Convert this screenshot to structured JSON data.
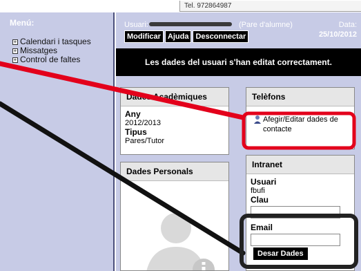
{
  "header": {
    "tel": "Tel. 972864987"
  },
  "menu": {
    "title": "Menú:",
    "items": [
      {
        "label": "Calendari i tasques"
      },
      {
        "label": "Missatges"
      },
      {
        "label": "Control de faltes"
      }
    ]
  },
  "user": {
    "label": "Usuari:",
    "role": "(Pare d'alumne)",
    "date_label": "Data:",
    "date": "25/10/2012"
  },
  "toolbar": {
    "modify": "Modificar",
    "help": "Ajuda",
    "logout": "Desconnectar"
  },
  "banner": "Les dades del usuari s'han editat correctament.",
  "academic": {
    "title": "Dades Acadèmiques",
    "year_label": "Any",
    "year": "2012/2013",
    "type_label": "Tipus",
    "type": "Pares/Tutor"
  },
  "phones": {
    "title": "Telèfons",
    "link": "Afegir/Editar dades de contacte"
  },
  "personal": {
    "title": "Dades Personals"
  },
  "intranet": {
    "title": "Intranet",
    "user_label": "Usuari",
    "user": "fbufi",
    "key_label": "Clau",
    "email_label": "Email",
    "save": "Desar Dades"
  },
  "annotations": {
    "red": "#e3001b",
    "dark": "#111111"
  }
}
